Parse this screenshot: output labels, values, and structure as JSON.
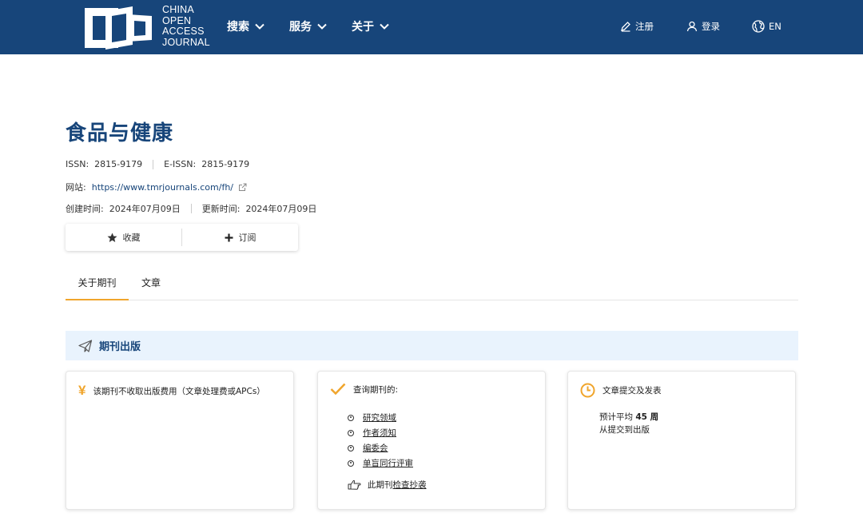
{
  "header": {
    "logo_lines": [
      "CHINA",
      "OPEN",
      "ACCESS",
      "JOURNAL"
    ],
    "nav": [
      {
        "label": "搜索"
      },
      {
        "label": "服务"
      },
      {
        "label": "关于"
      }
    ],
    "register_label": "注册",
    "login_label": "登录",
    "lang_label": "EN"
  },
  "journal": {
    "title": "食品与健康",
    "issn_label": "ISSN:",
    "issn": "2815-9179",
    "eissn_label": "E-ISSN:",
    "eissn": "2815-9179",
    "website_label": "网站:",
    "website": "https://www.tmrjournals.com/fh/",
    "created_label": "创建时间:",
    "created": "2024年07月09日",
    "updated_label": "更新时间:",
    "updated": "2024年07月09日"
  },
  "actions": {
    "favorite_label": "收藏",
    "subscribe_label": "订阅"
  },
  "tabs": [
    {
      "label": "关于期刊",
      "active": true
    },
    {
      "label": "文章",
      "active": false
    }
  ],
  "section": {
    "title": "期刊出版"
  },
  "cards": {
    "fees": {
      "icon": "¥",
      "text": "该期刊不收取出版费用（文章处理费或APCs）"
    },
    "query": {
      "heading": "查询期刊的:",
      "links": [
        "研究领域",
        "作者须知",
        "编委会",
        "单盲同行评审"
      ],
      "plagiarism_prefix": "此期刊",
      "plagiarism_link": "检查抄袭"
    },
    "timeline": {
      "heading": "文章提交及发表",
      "line1_prefix": "预计平均",
      "line1_value": "45 周",
      "line2": "从提交到出版"
    }
  },
  "colors": {
    "brand": "#17457a",
    "accent": "#f0a52c",
    "banner_bg": "#e9f3fd"
  }
}
